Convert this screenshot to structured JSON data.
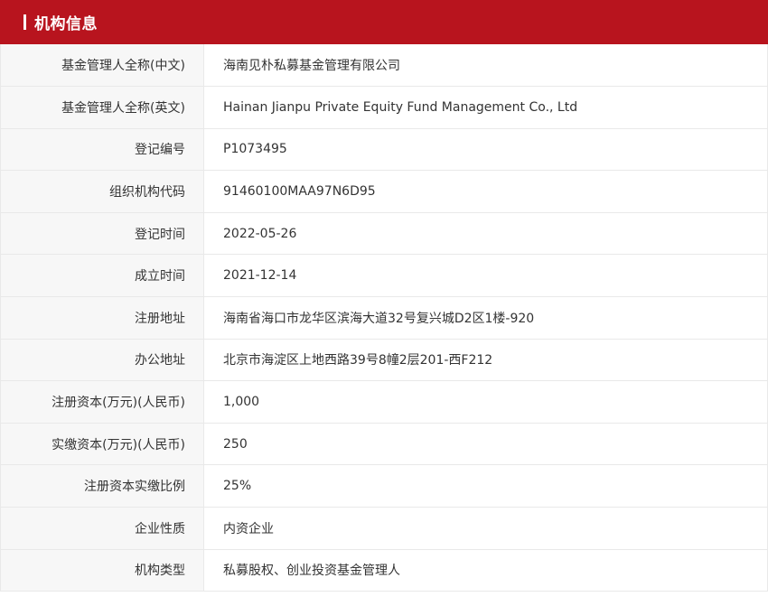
{
  "header": {
    "title": "机构信息",
    "accent_color": "#b8141e"
  },
  "rows": [
    {
      "label": "基金管理人全称(中文)",
      "value": "海南见朴私募基金管理有限公司"
    },
    {
      "label": "基金管理人全称(英文)",
      "value": "Hainan Jianpu Private Equity Fund Management Co., Ltd"
    },
    {
      "label": "登记编号",
      "value": "P1073495"
    },
    {
      "label": "组织机构代码",
      "value": "91460100MAA97N6D95"
    },
    {
      "label": "登记时间",
      "value": "2022-05-26"
    },
    {
      "label": "成立时间",
      "value": "2021-12-14"
    },
    {
      "label": "注册地址",
      "value": "海南省海口市龙华区滨海大道32号复兴城D2区1楼-920"
    },
    {
      "label": "办公地址",
      "value": "北京市海淀区上地西路39号8幢2层201-西F212"
    },
    {
      "label": "注册资本(万元)(人民币)",
      "value": "1,000"
    },
    {
      "label": "实缴资本(万元)(人民币)",
      "value": "250"
    },
    {
      "label": "注册资本实缴比例",
      "value": "25%"
    },
    {
      "label": "企业性质",
      "value": "内资企业"
    },
    {
      "label": "机构类型",
      "value": "私募股权、创业投资基金管理人"
    }
  ]
}
